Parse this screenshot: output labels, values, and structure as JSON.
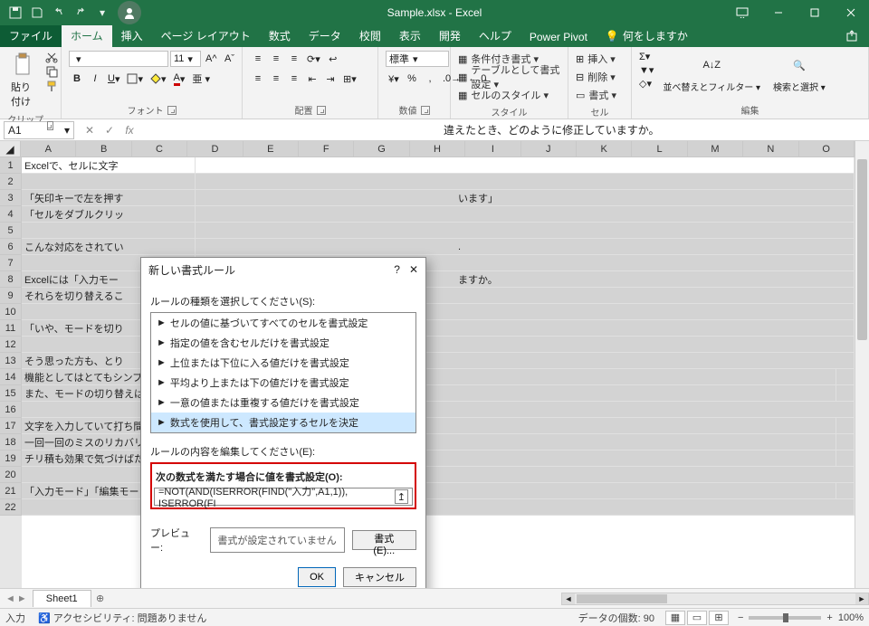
{
  "app": {
    "title": "Sample.xlsx - Excel"
  },
  "tabs": {
    "file": "ファイル",
    "home": "ホーム",
    "insert": "挿入",
    "pagelayout": "ページ レイアウト",
    "formulas": "数式",
    "data": "データ",
    "review": "校閲",
    "view": "表示",
    "developer": "開発",
    "help": "ヘルプ",
    "powerpivot": "Power Pivot",
    "tellme": "何をしますか",
    "share": "🔗"
  },
  "ribbon": {
    "clipboard_label": "クリップボード",
    "paste": "貼り付け",
    "font_label": "フォント",
    "font_size": "11",
    "align_label": "配置",
    "number_label": "数値",
    "number_fmt": "標準",
    "styles_label": "スタイル",
    "cond_fmt": "条件付き書式 ▾",
    "as_table": "テーブルとして書式設定 ▾",
    "cell_styles": "セルのスタイル ▾",
    "cells_label": "セル",
    "insert_cell": "挿入 ▾",
    "delete_cell": "削除 ▾",
    "format_cell": "書式 ▾",
    "editing_label": "編集",
    "sort": "並べ替えとフィルター ▾",
    "find": "検索と選択 ▾"
  },
  "namebox": "A1",
  "formula_visible": "違えたとき、どのように修正していますか。",
  "columns": [
    "A",
    "B",
    "C",
    "D",
    "E",
    "F",
    "G",
    "H",
    "I",
    "J",
    "K",
    "L",
    "M",
    "N",
    "O"
  ],
  "row_count": 22,
  "rows": {
    "1": "Excelで、セルに文字",
    "3": "「矢印キーで左を押す",
    "4": "「セルをダブルクリッ",
    "6": "こんな対応をされてい",
    "8": "Excelには「入力モー",
    "9": "それらを切り替えるこ",
    "11": "「いや、モードを切り",
    "13": "そう思った方も、とり",
    "14": "機能としてはとてもシンプルで、2,3回使ってみれば簡単に理解できます。",
    "15": "また、モードの切り替えは「F2」キーを押すだけなので、複雑な手順も必要ありません。",
    "17": "文字を入力していて打ち間違えをすることは誰にでもあります。",
    "18": "一回一回のミスのリカバリーにかかる時間は短くても、",
    "19": "チリ積も効果で気づけばたくさんの時間を無駄にしていたなんてことも起きかねません。",
    "21": "「入力モード」「編集モード」を使いこなし、作業を効率化していきましょう。"
  },
  "row_extra": {
    "6": ".",
    "8": "ますか。",
    "3": "います」"
  },
  "dialog": {
    "title": "新しい書式ルール",
    "sel_label": "ルールの種類を選択してください(S):",
    "items": [
      "セルの値に基づいてすべてのセルを書式設定",
      "指定の値を含むセルだけを書式設定",
      "上位または下位に入る値だけを書式設定",
      "平均より上または下の値だけを書式設定",
      "一意の値または重複する値だけを書式設定",
      "数式を使用して、書式設定するセルを決定"
    ],
    "edit_label": "ルールの内容を編集してください(E):",
    "formula_label": "次の数式を満たす場合に値を書式設定(O):",
    "formula_value": "=NOT(AND(ISERROR(FIND(\"入力\",A1,1)), ISERROR(FI",
    "preview_label": "プレビュー:",
    "preview_text": "書式が設定されていません",
    "fmt_btn": "書式(E)...",
    "ok": "OK",
    "cancel": "キャンセル"
  },
  "sheet": {
    "name": "Sheet1"
  },
  "status": {
    "mode": "入力",
    "acc": "アクセシビリティ: 問題ありません",
    "count": "データの個数: 90",
    "zoom": "100%"
  }
}
